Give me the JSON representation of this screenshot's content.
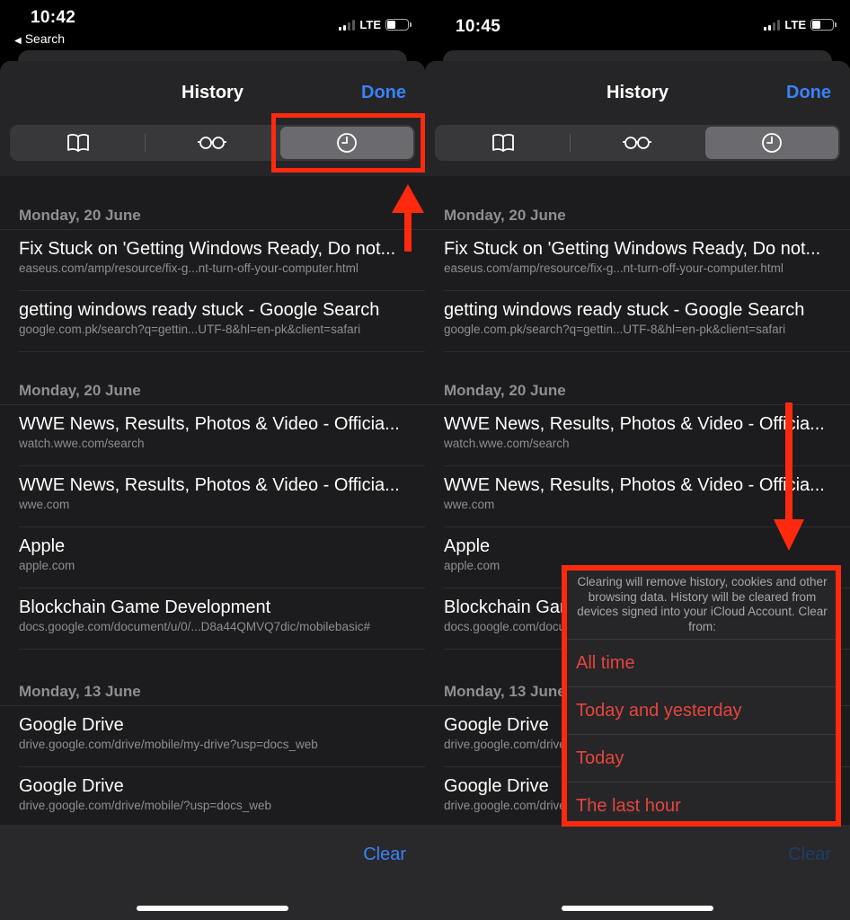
{
  "screens": [
    {
      "status": {
        "time": "10:42",
        "back_label": "Search",
        "network": "LTE",
        "signal_bars_on": 2,
        "signal_bars_total": 4,
        "battery_level": 0.35
      },
      "header": {
        "title": "History",
        "done_label": "Done"
      },
      "tabs": [
        {
          "icon": "book-icon",
          "label": "Bookmarks",
          "active": false
        },
        {
          "icon": "glasses-icon",
          "label": "Reading List",
          "active": false
        },
        {
          "icon": "clock-icon",
          "label": "History",
          "active": true
        }
      ],
      "sections": [
        {
          "date": "Monday, 20 June",
          "items": [
            {
              "title": "Fix Stuck on 'Getting Windows Ready, Do not...",
              "url": "easeus.com/amp/resource/fix-g...nt-turn-off-your-computer.html"
            },
            {
              "title": "getting windows ready stuck - Google Search",
              "url": "google.com.pk/search?q=gettin...UTF-8&hl=en-pk&client=safari"
            }
          ]
        },
        {
          "date": "Monday, 20 June",
          "items": [
            {
              "title": "WWE News, Results, Photos & Video - Officia...",
              "url": "watch.wwe.com/search"
            },
            {
              "title": "WWE News, Results, Photos & Video - Officia...",
              "url": "wwe.com"
            },
            {
              "title": "Apple",
              "url": "apple.com"
            },
            {
              "title": "Blockchain Game Development",
              "url": "docs.google.com/document/u/0/...D8a44QMVQ7dic/mobilebasic#"
            }
          ]
        },
        {
          "date": "Monday, 13 June",
          "items": [
            {
              "title": "Google Drive",
              "url": "drive.google.com/drive/mobile/my-drive?usp=docs_web"
            },
            {
              "title": "Google Drive",
              "url": "drive.google.com/drive/mobile/?usp=docs_web"
            }
          ]
        }
      ],
      "footer": {
        "clear_label": "Clear"
      }
    },
    {
      "status": {
        "time": "10:45",
        "network": "LTE",
        "signal_bars_on": 2,
        "signal_bars_total": 4,
        "battery_level": 0.35
      },
      "header": {
        "title": "History",
        "done_label": "Done"
      },
      "footer": {
        "clear_label": "Clear"
      },
      "clear_popover": {
        "message": "Clearing will remove history, cookies and other browsing data. History will be cleared from devices signed into your iCloud Account. Clear from:",
        "options": [
          "All time",
          "Today and yesterday",
          "Today",
          "The last hour"
        ]
      }
    }
  ],
  "colors": {
    "accent_blue": "#3a82f7",
    "destructive_red": "#e5453c",
    "annotation_red": "#ff2a0e",
    "background": "#1c1c1e"
  }
}
